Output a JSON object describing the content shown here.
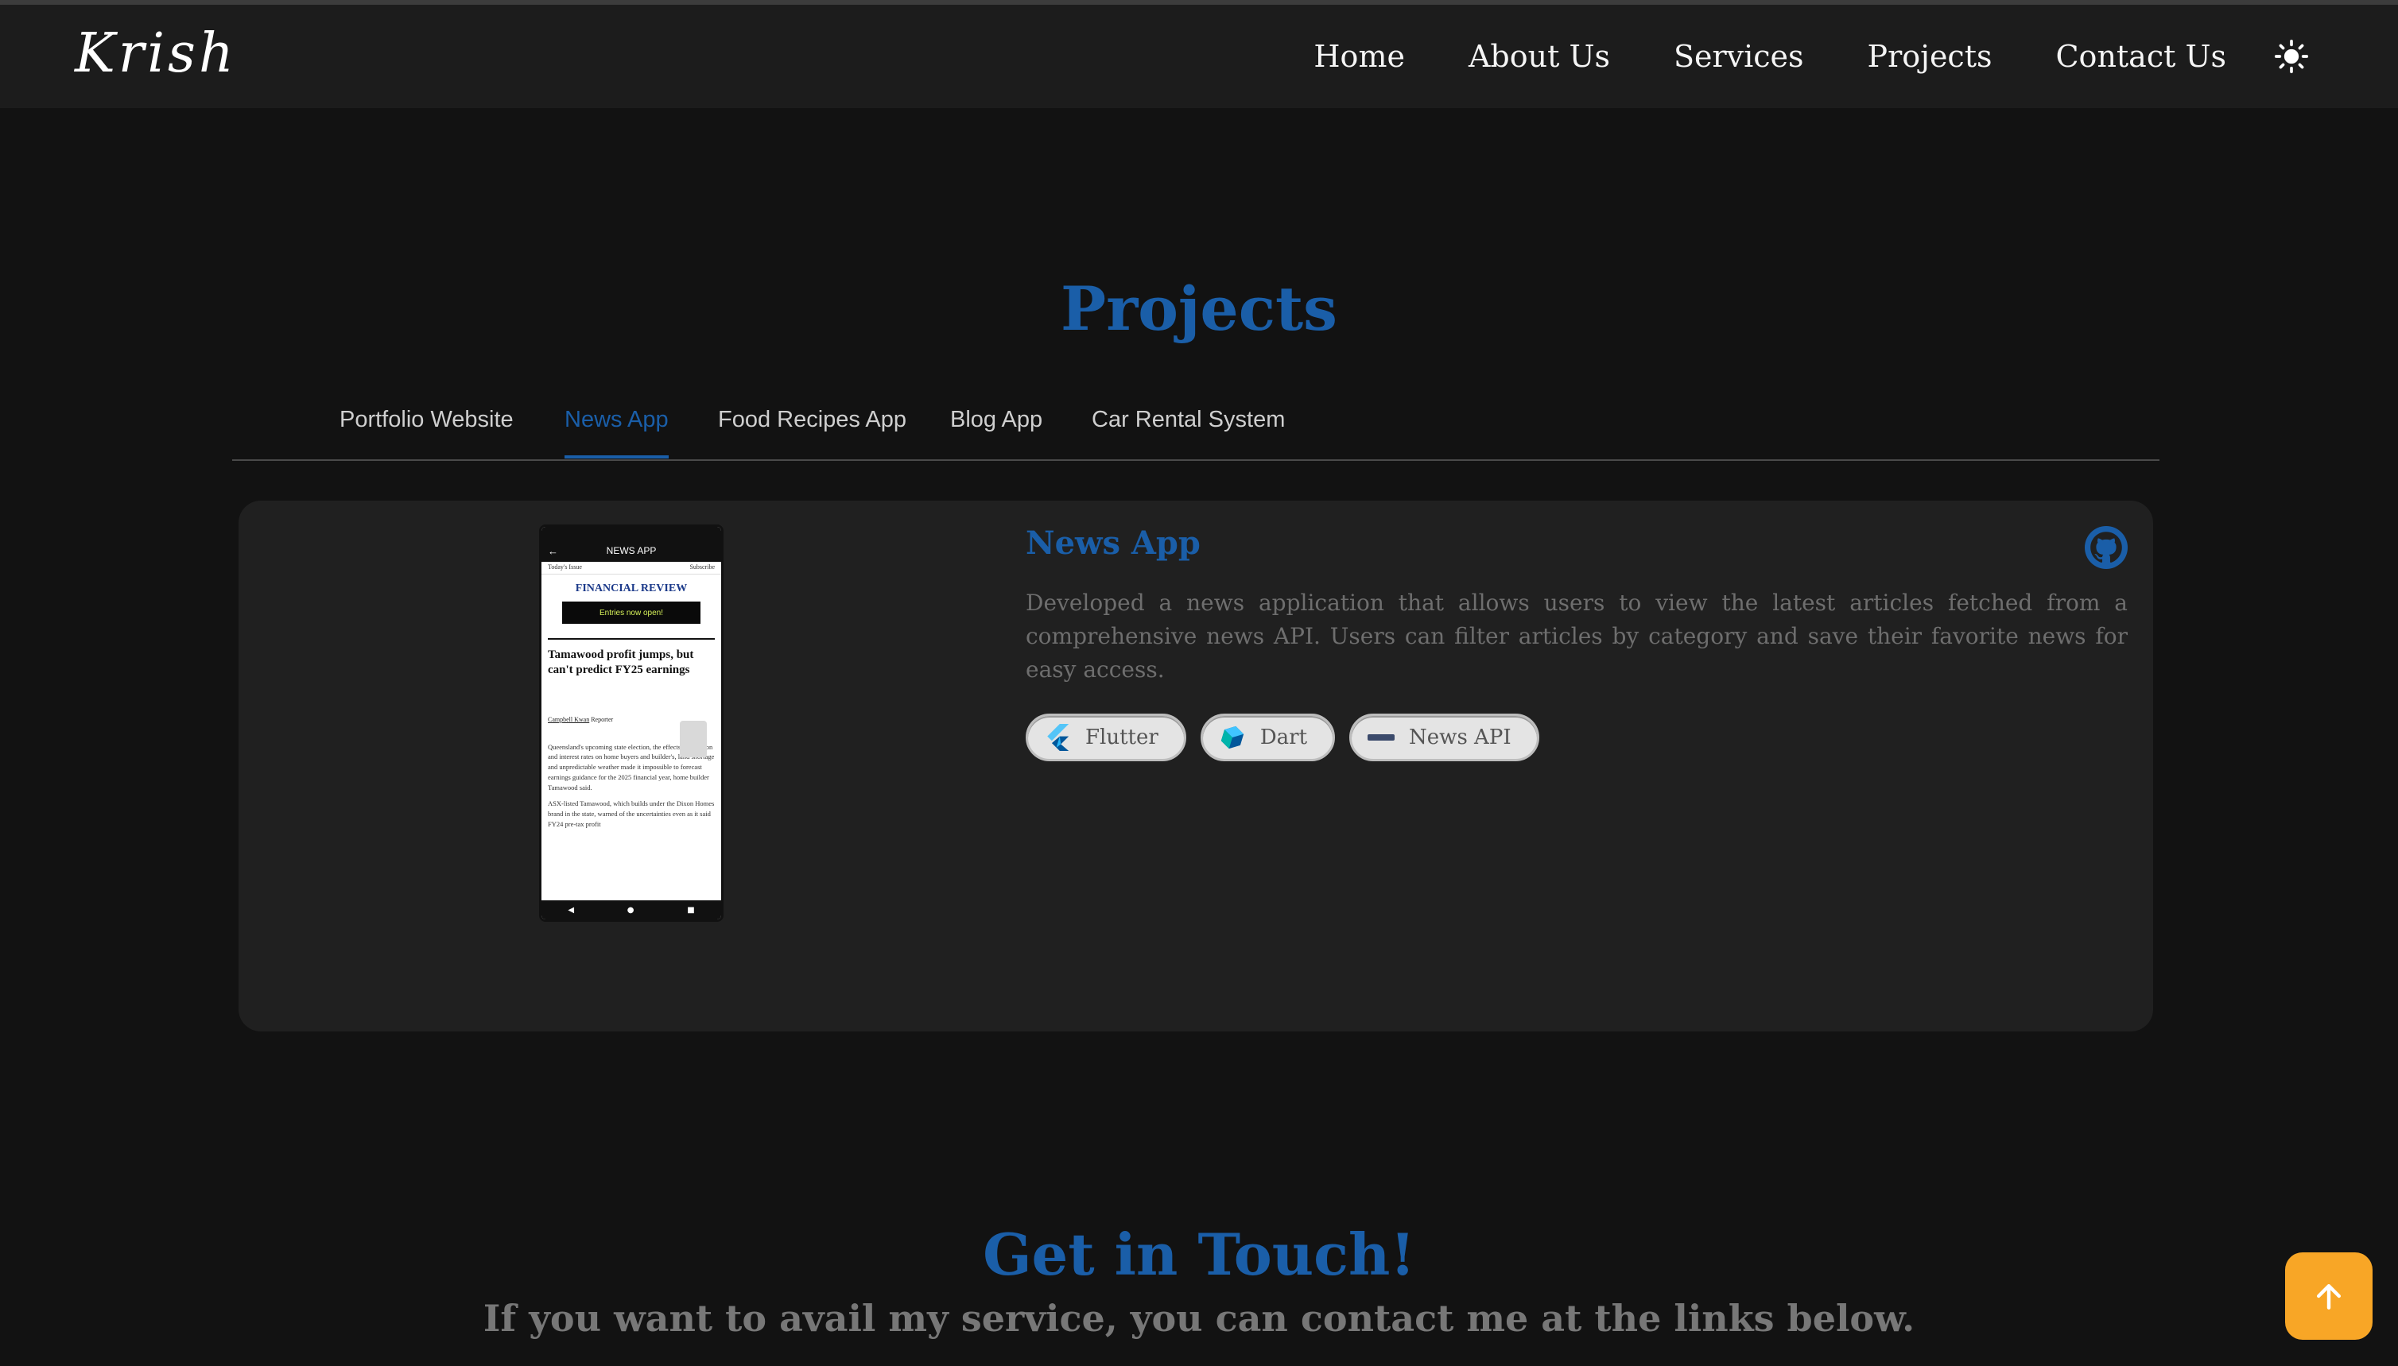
{
  "app": {
    "logo": "Krish"
  },
  "nav": {
    "items": [
      "Home",
      "About Us",
      "Services",
      "Projects",
      "Contact Us"
    ],
    "theme_icon": "sun-icon"
  },
  "projects": {
    "title": "Projects",
    "tabs": [
      "Portfolio Website",
      "News App",
      "Food Recipes App",
      "Blog App",
      "Car Rental System"
    ],
    "active_tab": "News App",
    "card": {
      "title": "News App",
      "description": "Developed a news application that allows users to view the latest articles fetched from a comprehensive news API. Users can filter articles by category and save their favorite news for easy access.",
      "github_icon": "github-icon",
      "tech": [
        {
          "label": "Flutter",
          "icon": "flutter-icon"
        },
        {
          "label": "Dart",
          "icon": "dart-icon"
        },
        {
          "label": "News API",
          "icon": "news-api-icon"
        }
      ],
      "screenshot": {
        "appbar_title": "NEWS APP",
        "today_label": "Today's Issue",
        "subscribe_label": "Subscribe",
        "masthead": "FINANCIAL REVIEW",
        "banner": "Entries now open!",
        "headline": "Tamawood profit jumps, but can't predict FY25 earnings",
        "author": "Campbell Kwan",
        "author_role": "Reporter",
        "body_1": "Queensland's upcoming state election, the effects of inflation and interest rates on home buyers and builder's, land shortage and unpredictable weather made it impossible to forecast earnings guidance for the 2025 financial year, home builder Tamawood said.",
        "body_2": "ASX-listed Tamawood, which builds under the Dixon Homes brand in the state, warned of the uncertainties even as it said FY24 pre-tax profit"
      }
    }
  },
  "contact": {
    "title": "Get in Touch!",
    "subtitle": "If you want to avail my service, you can contact me at the links below."
  },
  "colors": {
    "accent": "#1a5ea8",
    "background": "#121212",
    "navbar": "#1c1c1c",
    "card": "#202020",
    "scroll_button": "#f8a626"
  },
  "scroll_top_icon": "arrow-up-icon"
}
